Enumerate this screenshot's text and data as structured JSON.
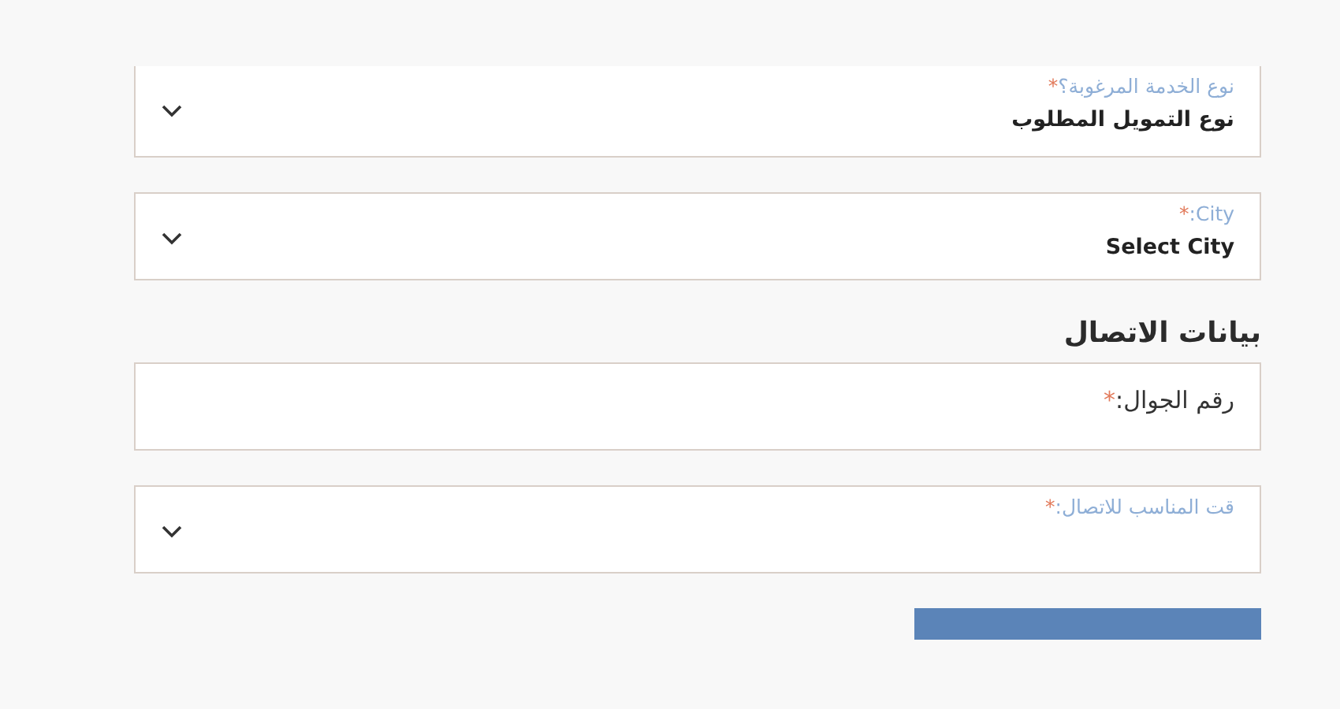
{
  "form": [
    {
      "kind": "select",
      "label": "نوع الخدمة المرغوبة؟",
      "required_mark": "*",
      "value": "نوع التمويل المطلوب"
    },
    {
      "kind": "select",
      "label": "City:",
      "required_mark": "*",
      "value": "Select City"
    },
    {
      "kind": "heading",
      "text": "بيانات الاتصال"
    },
    {
      "kind": "input",
      "label": "رقم الجوال:",
      "required_mark": "*"
    },
    {
      "kind": "select",
      "label": "قت المناسب للاتصال:",
      "required_mark": "*"
    }
  ]
}
